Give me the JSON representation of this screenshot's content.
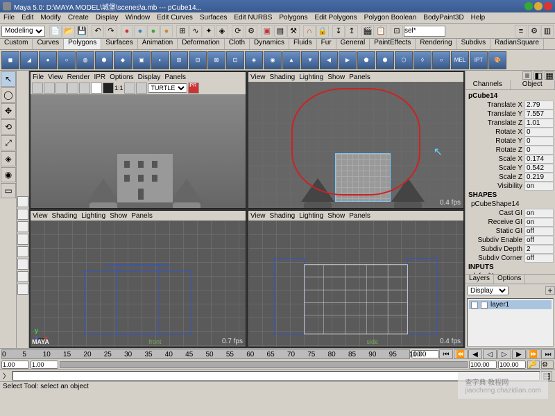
{
  "title": "Maya 5.0: D:\\MAYA MODEL\\城堡\\scenes\\a.mb --- pCube14...",
  "window_dots": {
    "g": "#3a3",
    "y": "#da3",
    "r": "#d33"
  },
  "main_menu": [
    "File",
    "Edit",
    "Modify",
    "Create",
    "Display",
    "Window",
    "Edit Curves",
    "Surfaces",
    "Edit NURBS",
    "Polygons",
    "Edit Polygons",
    "Polygon Boolean",
    "BodyPaint3D",
    "Help"
  ],
  "mode_selector": "Modeling",
  "quick_field": "sel*",
  "shelf_tabs": [
    "Custom",
    "Curves",
    "Polygons",
    "Surfaces",
    "Animation",
    "Deformation",
    "Cloth",
    "Dynamics",
    "Fluids",
    "Fur",
    "General",
    "PaintEffects",
    "Rendering",
    "Subdivs",
    "RadianSquare"
  ],
  "shelf_active": "Polygons",
  "vp_menu": [
    "View",
    "Shading",
    "Lighting",
    "Show",
    "Panels"
  ],
  "vp0_render_menu": [
    "File",
    "View",
    "Render",
    "IPR",
    "Options",
    "Display",
    "Panels"
  ],
  "renderer_sel": "TURTLE",
  "fps": {
    "vp0": "",
    "vp1": "0.4 fps",
    "vp2": "0.7 fps",
    "vp3": "0.4 fps"
  },
  "channels": {
    "tabs": [
      "Channels",
      "Object"
    ],
    "node": "pCube14",
    "attrs": [
      {
        "l": "Translate X",
        "v": "2.79"
      },
      {
        "l": "Translate Y",
        "v": "7.557"
      },
      {
        "l": "Translate Z",
        "v": "1.01"
      },
      {
        "l": "Rotate X",
        "v": "0"
      },
      {
        "l": "Rotate Y",
        "v": "0"
      },
      {
        "l": "Rotate Z",
        "v": "0"
      },
      {
        "l": "Scale X",
        "v": "0.174"
      },
      {
        "l": "Scale Y",
        "v": "0.542"
      },
      {
        "l": "Scale Z",
        "v": "0.219"
      },
      {
        "l": "Visibility",
        "v": "on"
      }
    ],
    "shapes_label": "SHAPES",
    "shape_node": "pCubeShape14",
    "shape_attrs": [
      {
        "l": "Cast GI",
        "v": "on"
      },
      {
        "l": "Receive GI",
        "v": "on"
      },
      {
        "l": "Static GI",
        "v": "off"
      },
      {
        "l": "Subdiv Enable",
        "v": "off"
      },
      {
        "l": "Subdiv Depth",
        "v": "2"
      },
      {
        "l": "Subdiv Corner",
        "v": "off"
      }
    ],
    "inputs_label": "INPUTS",
    "input_node": "defaultLayer"
  },
  "layers": {
    "tabs": [
      "Layers",
      "Options"
    ],
    "mode": "Display",
    "items": [
      "layer1"
    ]
  },
  "timeline": {
    "start": "1.00",
    "end": "100.00",
    "rstart": "1.00",
    "rend": "100.00",
    "ticks": [
      0,
      5,
      10,
      15,
      20,
      25,
      30,
      35,
      40,
      45,
      50,
      55,
      60,
      65,
      70,
      75,
      80,
      85,
      90,
      95,
      100
    ]
  },
  "helpline": "Select Tool: select an object",
  "watermark": "查字典 教程网",
  "watermark_url": "jiaocheng.chazidian.com",
  "maya_logo": "MAYA",
  "vp2_label": "front",
  "vp3_label": "side"
}
